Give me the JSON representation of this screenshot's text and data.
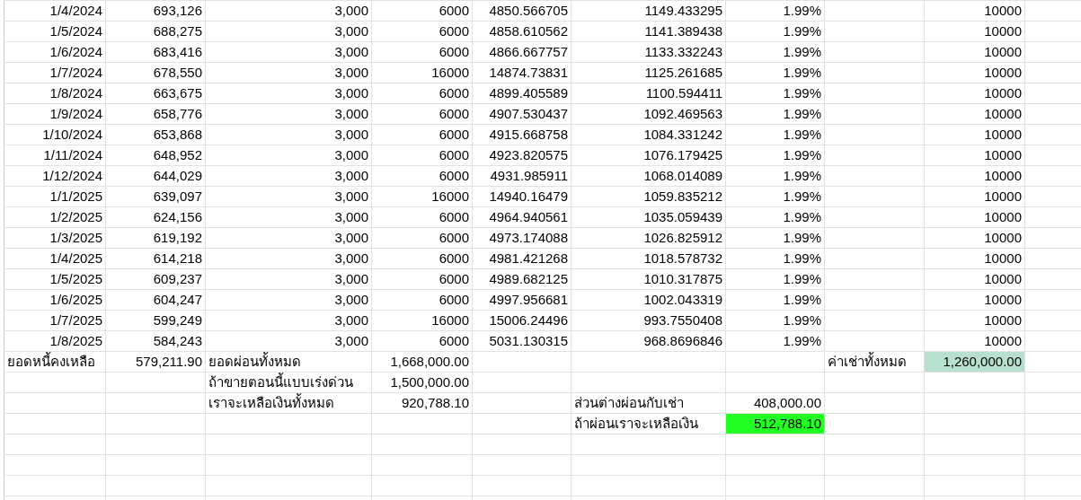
{
  "sheet": {
    "rows": [
      [
        "1/4/2024",
        "693,126",
        "3,000",
        "6000",
        "4850.566705",
        "1149.433295",
        "1.99%",
        null,
        "10000"
      ],
      [
        "1/5/2024",
        "688,275",
        "3,000",
        "6000",
        "4858.610562",
        "1141.389438",
        "1.99%",
        null,
        "10000"
      ],
      [
        "1/6/2024",
        "683,416",
        "3,000",
        "6000",
        "4866.667757",
        "1133.332243",
        "1.99%",
        null,
        "10000"
      ],
      [
        "1/7/2024",
        "678,550",
        "3,000",
        "16000",
        "14874.73831",
        "1125.261685",
        "1.99%",
        null,
        "10000"
      ],
      [
        "1/8/2024",
        "663,675",
        "3,000",
        "6000",
        "4899.405589",
        "1100.594411",
        "1.99%",
        null,
        "10000"
      ],
      [
        "1/9/2024",
        "658,776",
        "3,000",
        "6000",
        "4907.530437",
        "1092.469563",
        "1.99%",
        null,
        "10000"
      ],
      [
        "1/10/2024",
        "653,868",
        "3,000",
        "6000",
        "4915.668758",
        "1084.331242",
        "1.99%",
        null,
        "10000"
      ],
      [
        "1/11/2024",
        "648,952",
        "3,000",
        "6000",
        "4923.820575",
        "1076.179425",
        "1.99%",
        null,
        "10000"
      ],
      [
        "1/12/2024",
        "644,029",
        "3,000",
        "6000",
        "4931.985911",
        "1068.014089",
        "1.99%",
        null,
        "10000"
      ],
      [
        "1/1/2025",
        "639,097",
        "3,000",
        "16000",
        "14940.16479",
        "1059.835212",
        "1.99%",
        null,
        "10000"
      ],
      [
        "1/2/2025",
        "624,156",
        "3,000",
        "6000",
        "4964.940561",
        "1035.059439",
        "1.99%",
        null,
        "10000"
      ],
      [
        "1/3/2025",
        "619,192",
        "3,000",
        "6000",
        "4973.174088",
        "1026.825912",
        "1.99%",
        null,
        "10000"
      ],
      [
        "1/4/2025",
        "614,218",
        "3,000",
        "6000",
        "4981.421268",
        "1018.578732",
        "1.99%",
        null,
        "10000"
      ],
      [
        "1/5/2025",
        "609,237",
        "3,000",
        "6000",
        "4989.682125",
        "1010.317875",
        "1.99%",
        null,
        "10000"
      ],
      [
        "1/6/2025",
        "604,247",
        "3,000",
        "6000",
        "4997.956681",
        "1002.043319",
        "1.99%",
        null,
        "10000"
      ],
      [
        "1/7/2025",
        "599,249",
        "3,000",
        "16000",
        "15006.24496",
        "993.7550408",
        "1.99%",
        null,
        "10000"
      ],
      [
        "1/8/2025",
        "584,243",
        "3,000",
        "6000",
        "5031.130315",
        "968.8696846",
        "1.99%",
        null,
        "10000"
      ]
    ],
    "summary_rows": [
      [
        {
          "kind": "label",
          "text": "ยอดหนี้คงเหลือ"
        },
        {
          "kind": "number",
          "text": "579,211.90"
        },
        {
          "kind": "label",
          "text": "ยอดผ่อนทั้งหมด"
        },
        {
          "kind": "number",
          "text": "1,668,000.00"
        },
        null,
        null,
        null,
        {
          "kind": "label",
          "text": "ค่าเช่าทั้งหมด"
        },
        {
          "kind": "number",
          "text": "1,260,000.00",
          "color": "#b7e1cd"
        }
      ],
      [
        null,
        null,
        {
          "kind": "label",
          "text": "ถ้าขายตอนนี้แบบเร่งด่วน"
        },
        {
          "kind": "number",
          "text": "1,500,000.00"
        },
        null,
        null,
        null,
        null,
        null
      ],
      [
        null,
        null,
        {
          "kind": "label",
          "text": "เราจะเหลือเงินทั้งหมด"
        },
        {
          "kind": "number",
          "text": "920,788.10"
        },
        null,
        {
          "kind": "label",
          "text": "ส่วนต่างผ่อนกับเช่า"
        },
        {
          "kind": "number",
          "text": "408,000.00"
        },
        null,
        null
      ],
      [
        null,
        null,
        null,
        null,
        null,
        {
          "kind": "label",
          "text": "ถ้าผ่อนเราจะเหลือเงิน"
        },
        {
          "kind": "number",
          "text": "512,788.10",
          "color": "#22ff22"
        },
        null,
        null
      ]
    ]
  }
}
